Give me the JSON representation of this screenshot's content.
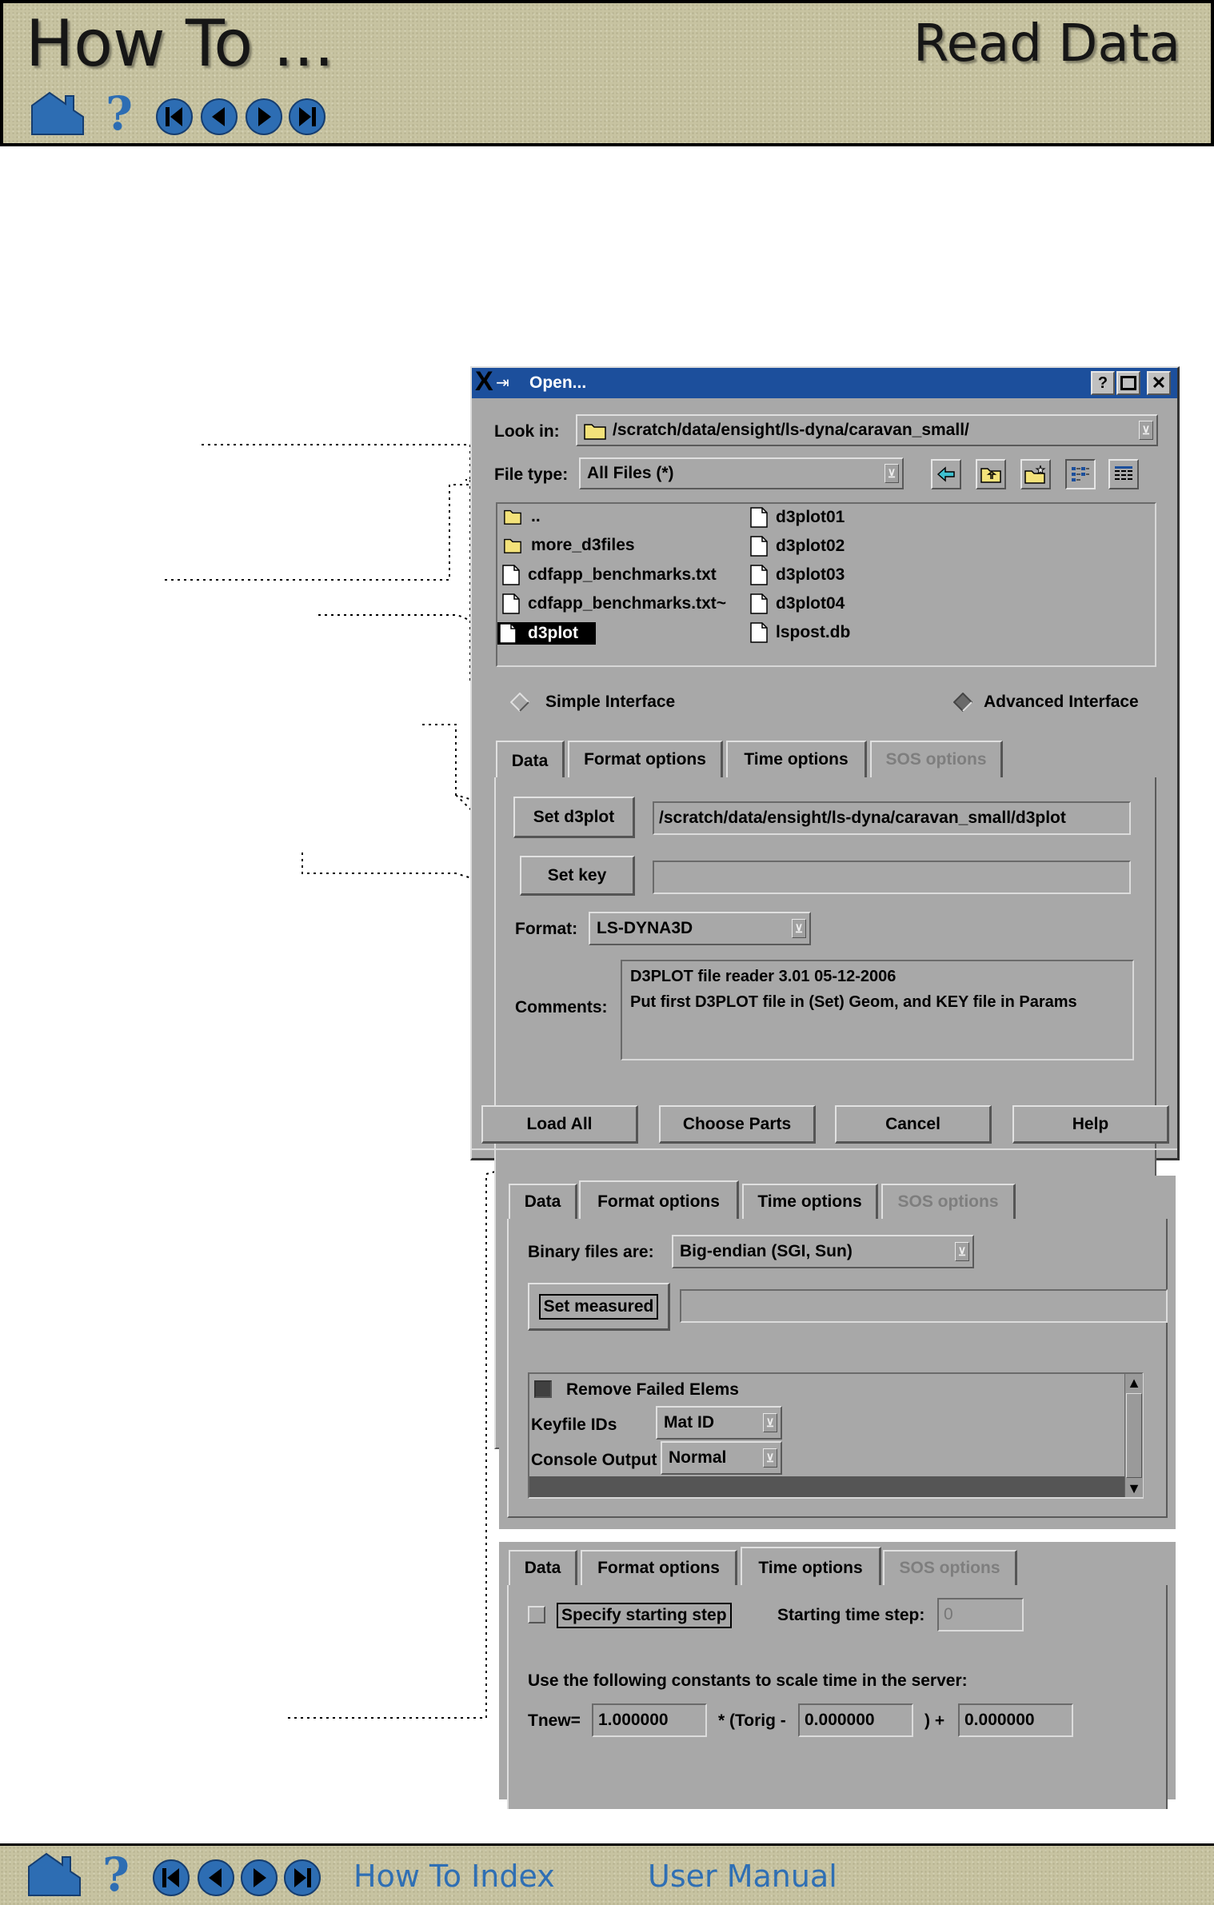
{
  "header": {
    "left_title": "How To ...",
    "right_title": "Read Data"
  },
  "footer": {
    "link_index": "How To Index",
    "link_manual": "User Manual"
  },
  "nav_icons": [
    "home-icon",
    "help-icon",
    "first-page-icon",
    "previous-page-icon",
    "next-page-icon",
    "last-page-icon"
  ],
  "open_dialog": {
    "title": "Open...",
    "look_in_label": "Look in:",
    "look_in_value": "/scratch/data/ensight/ls-dyna/caravan_small/",
    "file_type_label": "File type:",
    "file_type_value": "All Files (*)",
    "files_col1": [
      {
        "name": "..",
        "kind": "folder"
      },
      {
        "name": "more_d3files",
        "kind": "folder"
      },
      {
        "name": "cdfapp_benchmarks.txt",
        "kind": "file"
      },
      {
        "name": "cdfapp_benchmarks.txt~",
        "kind": "file"
      },
      {
        "name": "d3plot",
        "kind": "file",
        "selected": true
      }
    ],
    "files_col2": [
      {
        "name": "d3plot01",
        "kind": "file"
      },
      {
        "name": "d3plot02",
        "kind": "file"
      },
      {
        "name": "d3plot03",
        "kind": "file"
      },
      {
        "name": "d3plot04",
        "kind": "file"
      },
      {
        "name": "lspost.db",
        "kind": "file"
      }
    ],
    "simple_interface": "Simple Interface",
    "advanced_interface": "Advanced Interface",
    "tabs": [
      "Data",
      "Format options",
      "Time options",
      "SOS options"
    ],
    "set_d3plot_label": "Set d3plot",
    "set_d3plot_value": "/scratch/data/ensight/ls-dyna/caravan_small/d3plot",
    "set_key_label": "Set key",
    "set_key_value": "",
    "format_label": "Format:",
    "format_value": "LS-DYNA3D",
    "comments_label": "Comments:",
    "comments_line1": "D3PLOT file reader 3.01 05-12-2006",
    "comments_line2": "Put first D3PLOT file in (Set) Geom, and KEY file in Params",
    "buttons": {
      "load_all": "Load All",
      "choose_parts": "Choose Parts",
      "cancel": "Cancel",
      "help": "Help"
    }
  },
  "format_panel": {
    "tabs": [
      "Data",
      "Format options",
      "Time options",
      "SOS options"
    ],
    "binary_label": "Binary files are:",
    "binary_value": "Big-endian (SGI, Sun)",
    "set_measured_label": "Set measured",
    "set_measured_value": "",
    "remove_failed": "Remove Failed Elems",
    "keyfile_label": "Keyfile IDs",
    "keyfile_value": "Mat ID",
    "console_label": "Console Output",
    "console_value": "Normal"
  },
  "time_panel": {
    "tabs": [
      "Data",
      "Format options",
      "Time options",
      "SOS options"
    ],
    "specify_label": "Specify starting step",
    "start_step_label": "Starting time step:",
    "start_step_value": "0",
    "scale_text": "Use the following constants to scale time in the server:",
    "tnew_label": "Tnew=",
    "tnew_value": "1.000000",
    "torig_label": "* (Torig -",
    "torig_value": "0.000000",
    "plus_label": ") +",
    "offset_value": "0.000000"
  },
  "colors": {
    "header_bg": "#c7c3a1",
    "dialog_bg": "#a8a8a8",
    "titlebar": "#1c4f9c",
    "link": "#2f6fb4"
  }
}
